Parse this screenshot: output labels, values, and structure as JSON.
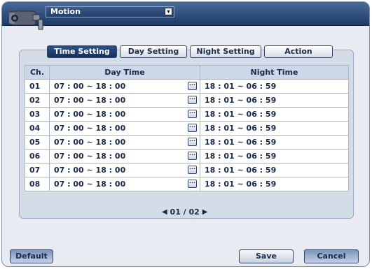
{
  "header": {
    "menu_value": "Motion",
    "menu_icon": "dropdown-icon"
  },
  "tabs": [
    {
      "label": "Time Setting",
      "active": true
    },
    {
      "label": "Day Setting",
      "active": false
    },
    {
      "label": "Night Setting",
      "active": false
    },
    {
      "label": "Action",
      "active": false
    }
  ],
  "table": {
    "headers": [
      "Ch.",
      "Day Time",
      "Night Time"
    ],
    "rows": [
      {
        "ch": "01",
        "day": "07 : 00 ~ 18 : 00",
        "night": "18 : 01 ~ 06 : 59"
      },
      {
        "ch": "02",
        "day": "07 : 00 ~ 18 : 00",
        "night": "18 : 01 ~ 06 : 59"
      },
      {
        "ch": "03",
        "day": "07 : 00 ~ 18 : 00",
        "night": "18 : 01 ~ 06 : 59"
      },
      {
        "ch": "04",
        "day": "07 : 00 ~ 18 : 00",
        "night": "18 : 01 ~ 06 : 59"
      },
      {
        "ch": "05",
        "day": "07 : 00 ~ 18 : 00",
        "night": "18 : 01 ~ 06 : 59"
      },
      {
        "ch": "06",
        "day": "07 : 00 ~ 18 : 00",
        "night": "18 : 01 ~ 06 : 59"
      },
      {
        "ch": "07",
        "day": "07 : 00 ~ 18 : 00",
        "night": "18 : 01 ~ 06 : 59"
      },
      {
        "ch": "08",
        "day": "07 : 00 ~ 18 : 00",
        "night": "18 : 01 ~ 06 : 59"
      }
    ],
    "edit_icon": "ellipsis-icon"
  },
  "pager": {
    "text": "01 / 02"
  },
  "buttons": {
    "default": "Default",
    "save": "Save",
    "cancel": "Cancel"
  }
}
